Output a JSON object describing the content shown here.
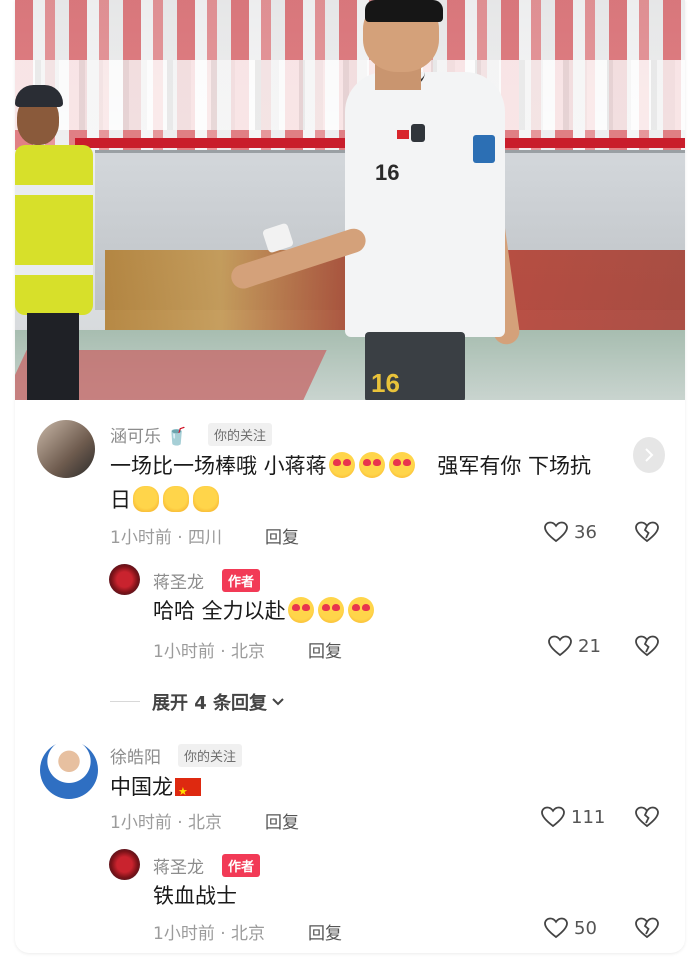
{
  "photo": {
    "jersey_number": "16",
    "shorts_number": "16"
  },
  "comments": [
    {
      "user": "涵可乐",
      "user_emoji": "🥤",
      "tag": "你的关注",
      "text_line1": "一场比一场棒哦 小蒋蒋",
      "text_line1_after": "强军有你 下场抗",
      "text_line2": "日",
      "meta": "1小时前 · 四川",
      "reply_label": "回复",
      "likes": "36",
      "replies": [
        {
          "user": "蒋圣龙",
          "tag": "作者",
          "text": "哈哈 全力以赴",
          "meta": "1小时前 · 北京",
          "reply_label": "回复",
          "likes": "21"
        }
      ],
      "expand_label": "展开 4 条回复"
    },
    {
      "user": "徐皓阳",
      "tag": "你的关注",
      "text": "中国龙",
      "meta": "1小时前 · 北京",
      "reply_label": "回复",
      "likes": "111",
      "replies": [
        {
          "user": "蒋圣龙",
          "tag": "作者",
          "text": "铁血战士",
          "meta": "1小时前 · 北京",
          "reply_label": "回复",
          "likes": "50"
        }
      ]
    }
  ],
  "icons": {
    "like": "heart-outline-icon",
    "dislike": "broken-heart-icon",
    "expand": "chevron-down-icon",
    "next": "chevron-right-icon"
  },
  "colors": {
    "author_tag": "#f23a56",
    "follow_tag_bg": "#f0f0f0"
  }
}
